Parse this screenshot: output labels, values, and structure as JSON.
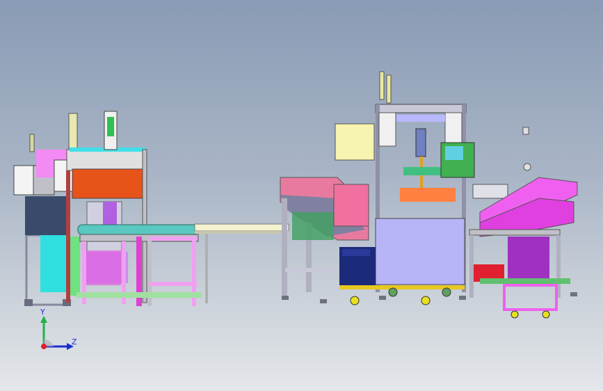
{
  "viewport": {
    "background_top": "#8a9bb5",
    "background_bottom": "#e4e7ea"
  },
  "triad": {
    "y_label": "Y",
    "z_label": "Z",
    "y_color": "#22b14c",
    "z_color": "#1a2fd0",
    "x_color": "#e0202c"
  },
  "model": {
    "name_icon": "assembly-line-model",
    "colors": {
      "frame": "#c9c9d4",
      "orange_guard": "#e8531a",
      "magenta": "#f05cf0",
      "pink_chute": "#e87aa0",
      "cyan": "#40e0e8",
      "lavender": "#b090f0",
      "light_blue_panel": "#b8b4f8",
      "yellow_box": "#f7f3b0",
      "navy": "#1c2a7a",
      "green": "#30b040",
      "turntable": "#58c8c0"
    }
  }
}
